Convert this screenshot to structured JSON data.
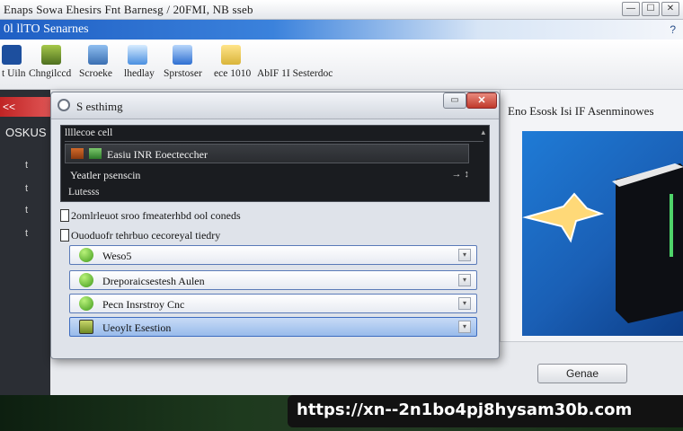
{
  "window": {
    "title": "Enaps Sowa Ehesirs Fnt Barnesg / 20FMI, NB sseb",
    "minimize": "—",
    "maximize": "☐",
    "close": "✕"
  },
  "header": {
    "title": "0l llTO Senarnes",
    "right_text": "?"
  },
  "ribbon": {
    "items": [
      {
        "label": "t Uiln",
        "color": "#1d4f9e"
      },
      {
        "label": "Chngilccd",
        "color": "#6a8a2a"
      },
      {
        "label": "Scroeke",
        "color": "#3a6fb2"
      },
      {
        "label": "lhedlay",
        "color": "#4a8fe0"
      },
      {
        "label": "Sprstoser",
        "color": "#2e6fd1"
      },
      {
        "label": "ece 1010",
        "color": "#d9b43a"
      },
      {
        "label": "AbIF 1I Sesterdoc",
        "color": "#ffffff"
      }
    ]
  },
  "left_panel": {
    "tab_label": "<<",
    "label": "OSKUS",
    "ticks": [
      "t",
      "t",
      "t",
      "t"
    ]
  },
  "dialog": {
    "title": "S esthimg",
    "minimize": "▭",
    "close": "✕",
    "dark_list": {
      "header": "llllecoe cell",
      "scroll": "▴",
      "selected_row": "Easiu INR Eoecteccher",
      "row2": "Yeatler psenscin",
      "row2_arrow": "→ ↕",
      "row3": "Lutesss"
    },
    "info_lines": [
      "2omlrleuot sroo fmeaterhbd ool coneds",
      "Ouoduofr tehrbuo cecoreyal tiedry"
    ],
    "options": [
      {
        "label": "Weso5",
        "icon": "green-orb"
      },
      {
        "label": "Dreporaicsestesh Aulen",
        "icon": "green-orb"
      },
      {
        "label": "Pecn Insrstroy Cnc",
        "icon": "green-orb"
      },
      {
        "label": "Ueoylt Esestion",
        "icon": "boxed"
      }
    ],
    "option_arrow": "▾"
  },
  "right_panel": {
    "title": "Eno Esosk Isi IF Asenminowes"
  },
  "bottom": {
    "button_label": "Genae"
  },
  "overlay": {
    "url": "https://xn--2n1bo4pj8hysam30b.com"
  }
}
